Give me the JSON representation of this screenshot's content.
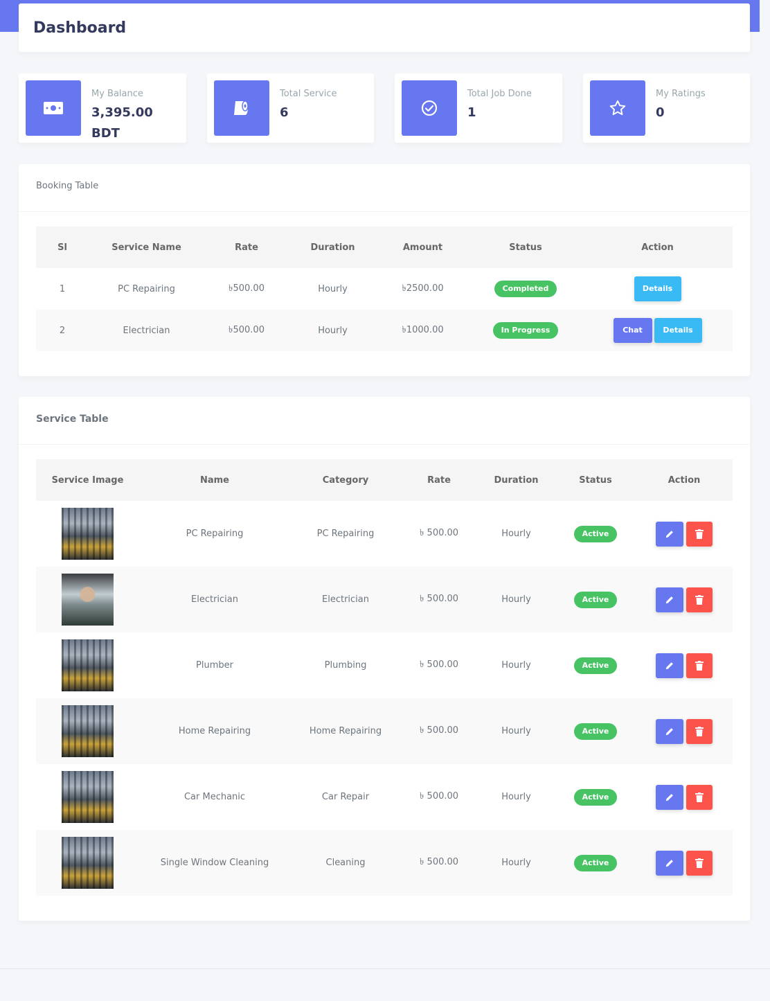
{
  "header": {
    "title": "Dashboard"
  },
  "stats": [
    {
      "label": "My Balance",
      "value": "3,395.00 BDT",
      "icon": "money-bill-icon"
    },
    {
      "label": "Total Service",
      "value": "6",
      "icon": "toilet-paper-icon"
    },
    {
      "label": "Total Job Done",
      "value": "1",
      "icon": "check-circle-icon"
    },
    {
      "label": "My Ratings",
      "value": "0",
      "icon": "star-icon"
    }
  ],
  "booking": {
    "title": "Booking Table",
    "columns": [
      "Sl",
      "Service Name",
      "Rate",
      "Duration",
      "Amount",
      "Status",
      "Action"
    ],
    "rows": [
      {
        "sl": "1",
        "name": "PC Repairing",
        "rate": "৳500.00",
        "duration": "Hourly",
        "amount": "৳2500.00",
        "status": "Completed",
        "details": "Details"
      },
      {
        "sl": "2",
        "name": "Electrician",
        "rate": "৳500.00",
        "duration": "Hourly",
        "amount": "৳1000.00",
        "status": "In Progress",
        "chat": "Chat",
        "details": "Details"
      }
    ]
  },
  "service": {
    "title": "Service Table",
    "columns": [
      "Service Image",
      "Name",
      "Category",
      "Rate",
      "Duration",
      "Status",
      "Action"
    ],
    "rows": [
      {
        "name": "PC Repairing",
        "category": "PC Repairing",
        "rate": "৳ 500.00",
        "duration": "Hourly",
        "status": "Active"
      },
      {
        "name": "Electrician",
        "category": "Electrician",
        "rate": "৳ 500.00",
        "duration": "Hourly",
        "status": "Active"
      },
      {
        "name": "Plumber",
        "category": "Plumbing",
        "rate": "৳ 500.00",
        "duration": "Hourly",
        "status": "Active"
      },
      {
        "name": "Home Repairing",
        "category": "Home Repairing",
        "rate": "৳ 500.00",
        "duration": "Hourly",
        "status": "Active"
      },
      {
        "name": "Car Mechanic",
        "category": "Car Repair",
        "rate": "৳ 500.00",
        "duration": "Hourly",
        "status": "Active"
      },
      {
        "name": "Single Window Cleaning",
        "category": "Cleaning",
        "rate": "৳ 500.00",
        "duration": "Hourly",
        "status": "Active"
      }
    ]
  },
  "colors": {
    "primary": "#6777ef",
    "success": "#47c363",
    "info": "#3abaf4",
    "danger": "#fc544b"
  }
}
